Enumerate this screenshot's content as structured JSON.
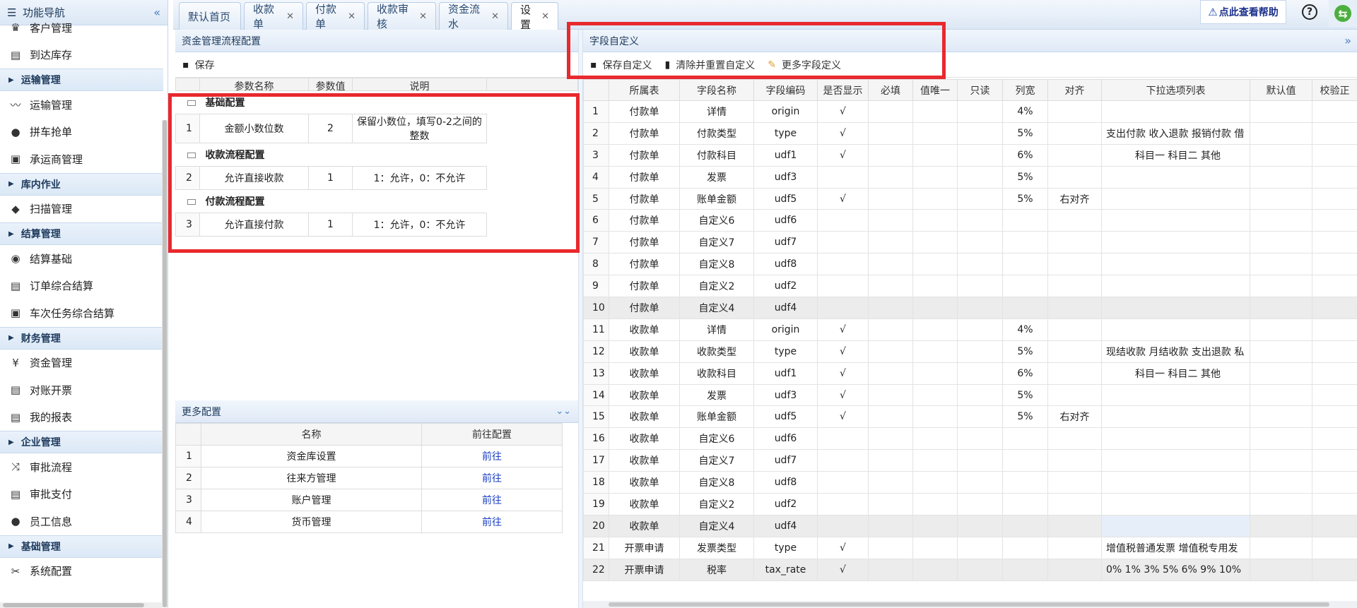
{
  "sidebar": {
    "title": "功能导航",
    "sections": [
      {
        "type": "item",
        "icon": "♛",
        "icon_name": "customer-icon",
        "label": "客户管理"
      },
      {
        "type": "item",
        "icon": "▤",
        "icon_name": "document-icon",
        "label": "到达库存"
      },
      {
        "type": "group",
        "label": "运输管理"
      },
      {
        "type": "item",
        "icon": "〰",
        "icon_name": "route-icon",
        "label": "运输管理"
      },
      {
        "type": "item",
        "icon": "●",
        "icon_name": "location-pin-icon",
        "label": "拼车抢单"
      },
      {
        "type": "item",
        "icon": "▣",
        "icon_name": "bus-icon",
        "label": "承运商管理"
      },
      {
        "type": "group",
        "label": "库内作业"
      },
      {
        "type": "item",
        "icon": "◆",
        "icon_name": "cube-icon",
        "label": "扫描管理"
      },
      {
        "type": "group",
        "label": "结算管理"
      },
      {
        "type": "item",
        "icon": "◉",
        "icon_name": "eye-icon",
        "label": "结算基础"
      },
      {
        "type": "item",
        "icon": "▤",
        "icon_name": "document-icon",
        "label": "订单综合结算"
      },
      {
        "type": "item",
        "icon": "▣",
        "icon_name": "bus-icon",
        "label": "车次任务综合结算"
      },
      {
        "type": "group",
        "label": "财务管理"
      },
      {
        "type": "item",
        "icon": "¥",
        "icon_name": "yen-icon",
        "label": "资金管理"
      },
      {
        "type": "item",
        "icon": "▤",
        "icon_name": "document-icon",
        "label": "对账开票"
      },
      {
        "type": "item",
        "icon": "▤",
        "icon_name": "document-icon",
        "label": "我的报表"
      },
      {
        "type": "group",
        "label": "企业管理"
      },
      {
        "type": "item",
        "icon": "⤨",
        "icon_name": "shuffle-icon",
        "label": "审批流程"
      },
      {
        "type": "item",
        "icon": "▤",
        "icon_name": "document-icon",
        "label": "审批支付"
      },
      {
        "type": "item",
        "icon": "●",
        "icon_name": "user-icon",
        "label": "员工信息"
      },
      {
        "type": "group",
        "label": "基础管理"
      },
      {
        "type": "item",
        "icon": "✂",
        "icon_name": "tools-icon",
        "label": "系统配置"
      }
    ]
  },
  "tabs": [
    {
      "label": "默认首页",
      "closable": false
    },
    {
      "label": "收款单",
      "closable": true
    },
    {
      "label": "付款单",
      "closable": true
    },
    {
      "label": "收款审核",
      "closable": true
    },
    {
      "label": "资金流水",
      "closable": true
    },
    {
      "label": "设置",
      "closable": true,
      "active": true
    }
  ],
  "header": {
    "help_label": "点此查看帮助",
    "question_label": "?",
    "sync_label": "⇆"
  },
  "config_panel": {
    "title": "资金管理流程配置",
    "save_label": "保存",
    "columns": [
      "参数名称",
      "参数值",
      "说明"
    ],
    "groups": [
      {
        "label": "基础配置",
        "rows": [
          {
            "idx": "1",
            "name": "金额小数位数",
            "value": "2",
            "desc": "保留小数位，填写0-2之间的整数"
          }
        ]
      },
      {
        "label": "收款流程配置",
        "rows": [
          {
            "idx": "2",
            "name": "允许直接收款",
            "value": "1",
            "desc": "1：允许，0：不允许"
          }
        ]
      },
      {
        "label": "付款流程配置",
        "rows": [
          {
            "idx": "3",
            "name": "允许直接付款",
            "value": "1",
            "desc": "1：允许，0：不允许"
          }
        ]
      }
    ]
  },
  "more_panel": {
    "title": "更多配置",
    "columns": [
      "名称",
      "前往配置"
    ],
    "rows": [
      {
        "idx": "1",
        "name": "资金库设置",
        "link": "前往"
      },
      {
        "idx": "2",
        "name": "往来方管理",
        "link": "前往"
      },
      {
        "idx": "3",
        "name": "账户管理",
        "link": "前往"
      },
      {
        "idx": "4",
        "name": "货币管理",
        "link": "前往"
      }
    ]
  },
  "field_panel": {
    "title": "字段自定义",
    "toolbar": {
      "save_label": "保存自定义",
      "clear_label": "清除并重置自定义",
      "more_label": "更多字段定义"
    },
    "columns": [
      "所属表",
      "字段名称",
      "字段编码",
      "是否显示",
      "必填",
      "值唯一",
      "只读",
      "列宽",
      "对齐",
      "下拉选项列表",
      "默认值",
      "校验正"
    ],
    "rows": [
      {
        "idx": "1",
        "table": "付款单",
        "name": "详情",
        "code": "origin",
        "show": "√",
        "width": "4%",
        "align": "",
        "opts": ""
      },
      {
        "idx": "2",
        "table": "付款单",
        "name": "付款类型",
        "code": "type",
        "show": "√",
        "width": "5%",
        "align": "",
        "opts": "支出付款 收入退款 报销付款 借"
      },
      {
        "idx": "3",
        "table": "付款单",
        "name": "付款科目",
        "code": "udf1",
        "show": "√",
        "width": "6%",
        "align": "",
        "opts": "科目一 科目二 其他"
      },
      {
        "idx": "4",
        "table": "付款单",
        "name": "发票",
        "code": "udf3",
        "show": "",
        "width": "5%",
        "align": "",
        "opts": ""
      },
      {
        "idx": "5",
        "table": "付款单",
        "name": "账单金额",
        "code": "udf5",
        "show": "√",
        "width": "5%",
        "align": "右对齐",
        "opts": ""
      },
      {
        "idx": "6",
        "table": "付款单",
        "name": "自定义6",
        "code": "udf6",
        "show": "",
        "width": "",
        "align": "",
        "opts": ""
      },
      {
        "idx": "7",
        "table": "付款单",
        "name": "自定义7",
        "code": "udf7",
        "show": "",
        "width": "",
        "align": "",
        "opts": ""
      },
      {
        "idx": "8",
        "table": "付款单",
        "name": "自定义8",
        "code": "udf8",
        "show": "",
        "width": "",
        "align": "",
        "opts": ""
      },
      {
        "idx": "9",
        "table": "付款单",
        "name": "自定义2",
        "code": "udf2",
        "show": "",
        "width": "",
        "align": "",
        "opts": ""
      },
      {
        "idx": "10",
        "table": "付款单",
        "name": "自定义4",
        "code": "udf4",
        "show": "",
        "width": "",
        "align": "",
        "opts": ""
      },
      {
        "idx": "11",
        "table": "收款单",
        "name": "详情",
        "code": "origin",
        "show": "√",
        "width": "4%",
        "align": "",
        "opts": ""
      },
      {
        "idx": "12",
        "table": "收款单",
        "name": "收款类型",
        "code": "type",
        "show": "√",
        "width": "5%",
        "align": "",
        "opts": "现结收款 月结收款 支出退款 私"
      },
      {
        "idx": "13",
        "table": "收款单",
        "name": "收款科目",
        "code": "udf1",
        "show": "√",
        "width": "6%",
        "align": "",
        "opts": "科目一 科目二 其他"
      },
      {
        "idx": "14",
        "table": "收款单",
        "name": "发票",
        "code": "udf3",
        "show": "√",
        "width": "5%",
        "align": "",
        "opts": ""
      },
      {
        "idx": "15",
        "table": "收款单",
        "name": "账单金额",
        "code": "udf5",
        "show": "√",
        "width": "5%",
        "align": "右对齐",
        "opts": ""
      },
      {
        "idx": "16",
        "table": "收款单",
        "name": "自定义6",
        "code": "udf6",
        "show": "",
        "width": "",
        "align": "",
        "opts": ""
      },
      {
        "idx": "17",
        "table": "收款单",
        "name": "自定义7",
        "code": "udf7",
        "show": "",
        "width": "",
        "align": "",
        "opts": ""
      },
      {
        "idx": "18",
        "table": "收款单",
        "name": "自定义8",
        "code": "udf8",
        "show": "",
        "width": "",
        "align": "",
        "opts": ""
      },
      {
        "idx": "19",
        "table": "收款单",
        "name": "自定义2",
        "code": "udf2",
        "show": "",
        "width": "",
        "align": "",
        "opts": ""
      },
      {
        "idx": "20",
        "table": "收款单",
        "name": "自定义4",
        "code": "udf4",
        "show": "",
        "width": "",
        "align": "",
        "opts": ""
      },
      {
        "idx": "21",
        "table": "开票申请",
        "name": "发票类型",
        "code": "type",
        "show": "√",
        "width": "",
        "align": "",
        "opts": "增值税普通发票 增值税专用发"
      },
      {
        "idx": "22",
        "table": "开票申请",
        "name": "税率",
        "code": "tax_rate",
        "show": "√",
        "width": "",
        "align": "",
        "opts": "0% 1% 3% 5% 6% 9% 10%"
      }
    ]
  },
  "colors": {
    "accent": "#4a7fc1",
    "highlight_box": "#e8292e",
    "link": "#1a3fc4"
  }
}
